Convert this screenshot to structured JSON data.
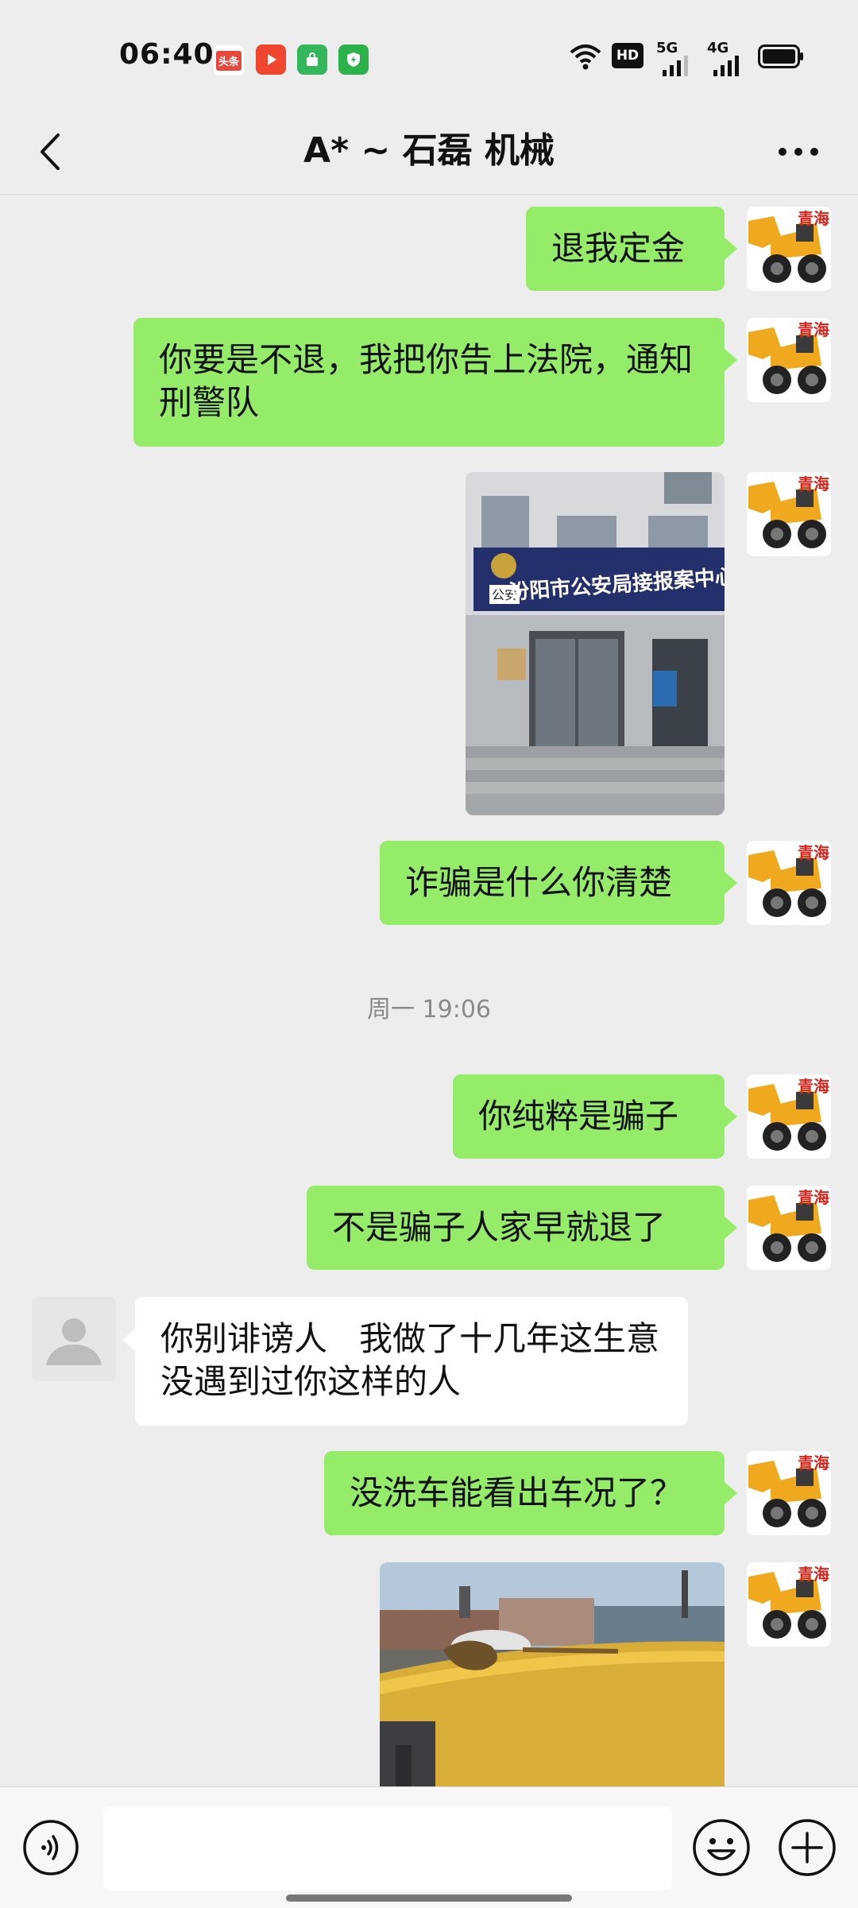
{
  "status_bar": {
    "time": "06:40",
    "badges": [
      {
        "label": "头条",
        "color": "#e8473c"
      },
      {
        "label": "",
        "color": "#f0452e"
      },
      {
        "label": "",
        "color": "#34b65a"
      },
      {
        "label": "",
        "color": "#2cb24a"
      }
    ],
    "hd_label": "HD",
    "net1": "5G",
    "net2": "4G"
  },
  "header": {
    "title": "A* ~ 石磊 机械"
  },
  "avatar": {
    "self_text": "青海",
    "colors": {
      "machine": "#f0a91e",
      "text": "#d9261c"
    }
  },
  "messages": [
    {
      "text": "退我定金"
    },
    {
      "text": "你要是不退，我把你告上法院，通知刑警队"
    },
    {
      "type": "image",
      "sign_text": "汾阳市公安局接报案中心",
      "emblem_text": "公安"
    },
    {
      "text": "诈骗是什么你清楚"
    },
    {
      "text": "你纯粹是骗子"
    },
    {
      "text": "不是骗子人家早就退了"
    },
    {
      "text": "你别诽谤人   我做了十几年这生意   没遇到过你这样的人"
    },
    {
      "text": "没洗车能看出车况了？"
    },
    {
      "type": "image"
    }
  ],
  "timestamp": "周一 19:06",
  "colors": {
    "outgoing_bubble": "#95ec69",
    "incoming_bubble": "#ffffff",
    "background": "#ededed"
  }
}
